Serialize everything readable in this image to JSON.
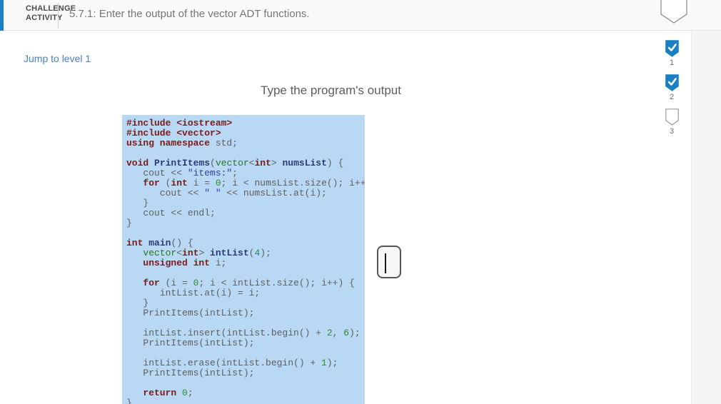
{
  "header": {
    "activity_line1": "CHALLENGE",
    "activity_line2": "ACTIVITY",
    "title": "5.7.1: Enter the output of the vector ADT functions."
  },
  "nav": {
    "jump_link": "Jump to level 1"
  },
  "prompt": {
    "heading": "Type the program's output"
  },
  "progress": {
    "items": [
      {
        "label": "1",
        "state": "complete"
      },
      {
        "label": "2",
        "state": "complete"
      },
      {
        "label": "3",
        "state": "incomplete"
      }
    ]
  },
  "answer": {
    "value": "",
    "placeholder": ""
  },
  "colors": {
    "accent": "#1b7fc4",
    "code-bg": "#b9d8f4",
    "kw": "#7e1a1a",
    "plain": "#5f5f5f",
    "decl": "#2b3a77",
    "ty": "#237a23",
    "nu": "#2b8f2b",
    "str": "#3140b0",
    "link": "#4b80c0",
    "title-gray": "#767676"
  },
  "code": {
    "lines": [
      [
        {
          "t": "#include <iostream>",
          "c": "k"
        }
      ],
      [
        {
          "t": "#include <vector>",
          "c": "k"
        }
      ],
      [
        {
          "t": "using namespace",
          "c": "k"
        },
        {
          "t": " std;",
          "c": "p"
        }
      ],
      [],
      [
        {
          "t": "void",
          "c": "k"
        },
        {
          "t": " ",
          "c": "p"
        },
        {
          "t": "PrintItems",
          "c": "d"
        },
        {
          "t": "(",
          "c": "p"
        },
        {
          "t": "vector",
          "c": "ty"
        },
        {
          "t": "<",
          "c": "p"
        },
        {
          "t": "int",
          "c": "k"
        },
        {
          "t": "> ",
          "c": "p"
        },
        {
          "t": "numsList",
          "c": "d"
        },
        {
          "t": ") {",
          "c": "p"
        }
      ],
      [
        {
          "t": "   cout << ",
          "c": "p"
        },
        {
          "t": "\"items:\"",
          "c": "s"
        },
        {
          "t": ";",
          "c": "p"
        }
      ],
      [
        {
          "t": "   ",
          "c": "p"
        },
        {
          "t": "for",
          "c": "k"
        },
        {
          "t": " (",
          "c": "p"
        },
        {
          "t": "int",
          "c": "k"
        },
        {
          "t": " i = ",
          "c": "p"
        },
        {
          "t": "0",
          "c": "nu"
        },
        {
          "t": "; i < numsList.size(); i++) {",
          "c": "p"
        }
      ],
      [
        {
          "t": "      cout << ",
          "c": "p"
        },
        {
          "t": "\" \"",
          "c": "s"
        },
        {
          "t": " << numsList.at(i);",
          "c": "p"
        }
      ],
      [
        {
          "t": "   }",
          "c": "p"
        }
      ],
      [
        {
          "t": "   cout << endl;",
          "c": "p"
        }
      ],
      [
        {
          "t": "}",
          "c": "p"
        }
      ],
      [],
      [
        {
          "t": "int",
          "c": "k"
        },
        {
          "t": " ",
          "c": "p"
        },
        {
          "t": "main",
          "c": "d"
        },
        {
          "t": "() {",
          "c": "p"
        }
      ],
      [
        {
          "t": "   ",
          "c": "p"
        },
        {
          "t": "vector",
          "c": "ty"
        },
        {
          "t": "<",
          "c": "p"
        },
        {
          "t": "int",
          "c": "k"
        },
        {
          "t": "> ",
          "c": "p"
        },
        {
          "t": "intList",
          "c": "d"
        },
        {
          "t": "(",
          "c": "p"
        },
        {
          "t": "4",
          "c": "nu"
        },
        {
          "t": ");",
          "c": "p"
        }
      ],
      [
        {
          "t": "   ",
          "c": "p"
        },
        {
          "t": "unsigned int",
          "c": "k"
        },
        {
          "t": " i;",
          "c": "p"
        }
      ],
      [],
      [
        {
          "t": "   ",
          "c": "p"
        },
        {
          "t": "for",
          "c": "k"
        },
        {
          "t": " (i = ",
          "c": "p"
        },
        {
          "t": "0",
          "c": "nu"
        },
        {
          "t": "; i < intList.size(); i++) {",
          "c": "p"
        }
      ],
      [
        {
          "t": "      intList.at(i) = i;",
          "c": "p"
        }
      ],
      [
        {
          "t": "   }",
          "c": "p"
        }
      ],
      [
        {
          "t": "   PrintItems(intList);",
          "c": "p"
        }
      ],
      [],
      [
        {
          "t": "   intList.insert(intList.begin() + ",
          "c": "p"
        },
        {
          "t": "2",
          "c": "nu"
        },
        {
          "t": ", ",
          "c": "p"
        },
        {
          "t": "6",
          "c": "nu"
        },
        {
          "t": ");",
          "c": "p"
        }
      ],
      [
        {
          "t": "   PrintItems(intList);",
          "c": "p"
        }
      ],
      [],
      [
        {
          "t": "   intList.erase(intList.begin() + ",
          "c": "p"
        },
        {
          "t": "1",
          "c": "nu"
        },
        {
          "t": ");",
          "c": "p"
        }
      ],
      [
        {
          "t": "   PrintItems(intList);",
          "c": "p"
        }
      ],
      [],
      [
        {
          "t": "   ",
          "c": "p"
        },
        {
          "t": "return",
          "c": "k"
        },
        {
          "t": " ",
          "c": "p"
        },
        {
          "t": "0",
          "c": "nu"
        },
        {
          "t": ";",
          "c": "p"
        }
      ],
      [
        {
          "t": "}",
          "c": "p"
        }
      ]
    ]
  }
}
